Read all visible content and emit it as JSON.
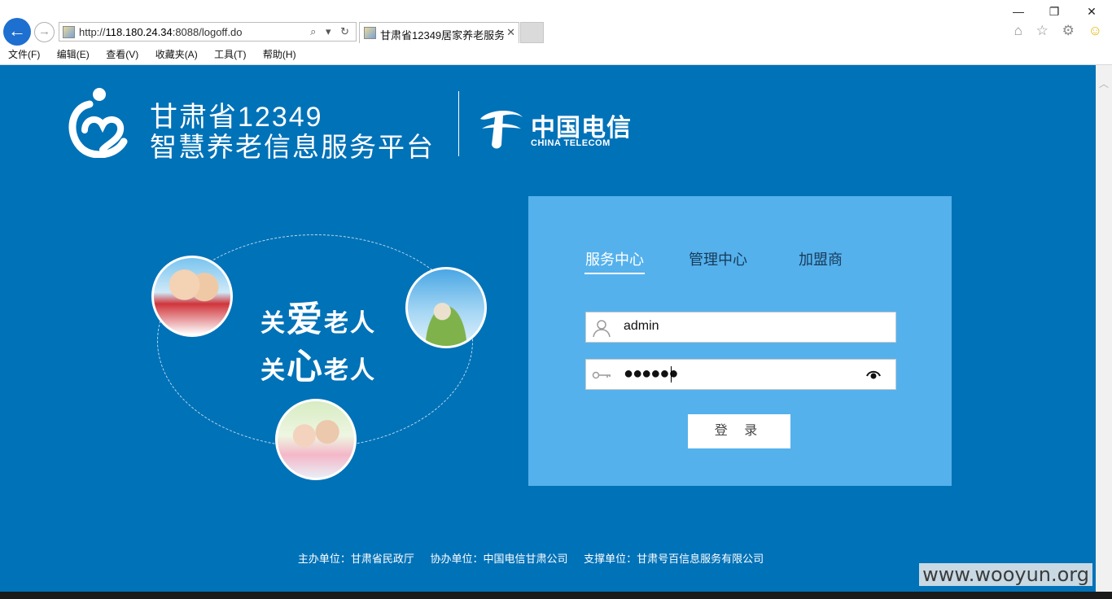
{
  "browser": {
    "window_controls": {
      "minimize": "—",
      "restore": "❐",
      "close": "✕"
    },
    "back": "←",
    "forward": "→",
    "url_prefix": "http://",
    "url_host": "118.180.24.34",
    "url_rest": ":8088/logoff.do",
    "address_tools": "⌕ ▾ ↻",
    "tab_title": "甘肃省12349居家养老服务...",
    "tab_close": "✕",
    "toolbar_icons": {
      "home": "⌂",
      "star": "☆",
      "gear": "⚙",
      "smile": "☺"
    },
    "menu": [
      "文件(F)",
      "编辑(E)",
      "查看(V)",
      "收藏夹(A)",
      "工具(T)",
      "帮助(H)"
    ]
  },
  "header": {
    "brand_line1": "甘肃省12349",
    "brand_line2": "智慧养老信息服务平台",
    "partner_cn": "中国电信",
    "partner_en": "CHINA TELECOM"
  },
  "illustration": {
    "slogan_1_pre": "关",
    "slogan_1_big": "爱",
    "slogan_1_post": "老人",
    "slogan_2_pre": "关",
    "slogan_2_big": "心",
    "slogan_2_post": "老人"
  },
  "login": {
    "tabs": [
      {
        "label": "服务中心",
        "active": true
      },
      {
        "label": "管理中心",
        "active": false
      },
      {
        "label": "加盟商",
        "active": false
      }
    ],
    "username": "admin",
    "password_mask": "●●●●●●",
    "submit": "登 录"
  },
  "footer": {
    "host": "主办单位：甘肃省民政厅",
    "co_host": "协办单位：中国电信甘肃公司",
    "support": "支撑单位：甘肃号百信息服务有限公司"
  },
  "watermark": "www.wooyun.org",
  "colors": {
    "page_bg": "#0072b8",
    "panel_bg": "#55b1ec",
    "browser_back": "#1d6fd0"
  }
}
